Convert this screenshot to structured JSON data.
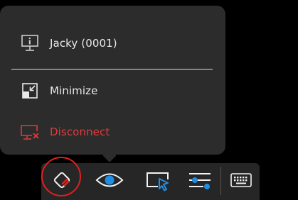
{
  "popup_menu": {
    "session_label": "Jacky (0001)",
    "minimize_label": "Minimize",
    "disconnect_label": "Disconnect",
    "icons": {
      "session": "monitor-info-icon",
      "minimize": "minimize-window-icon",
      "disconnect": "disconnect-monitor-icon"
    }
  },
  "toolbar": {
    "buttons": [
      {
        "name": "collapse-toolbar-button",
        "icon": "eraser-icon",
        "active": true
      },
      {
        "name": "view-only-button",
        "icon": "eye-icon"
      },
      {
        "name": "remote-control-button",
        "icon": "screen-cursor-icon"
      },
      {
        "name": "settings-button",
        "icon": "sliders-icon"
      },
      {
        "name": "keyboard-button",
        "icon": "keyboard-icon"
      }
    ]
  },
  "colors": {
    "accent": "#1f8fe6",
    "danger": "#e23a3a",
    "highlight_ring": "#e02020",
    "menu_bg": "#2c2c2c",
    "toolbar_bg": "#262626"
  }
}
